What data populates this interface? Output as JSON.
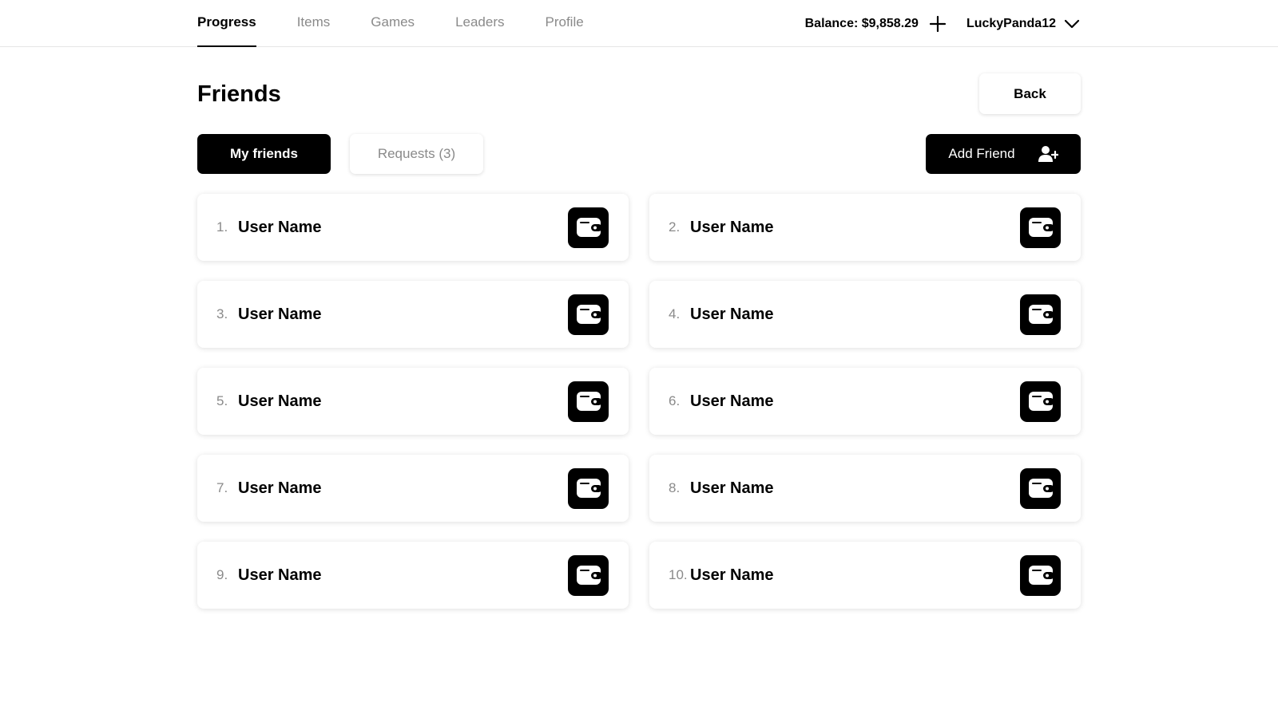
{
  "nav": {
    "items": [
      {
        "label": "Progress",
        "active": true
      },
      {
        "label": "Items",
        "active": false
      },
      {
        "label": "Games",
        "active": false
      },
      {
        "label": "Leaders",
        "active": false
      },
      {
        "label": "Profile",
        "active": false
      }
    ]
  },
  "header": {
    "balance_label": "Balance: $9,858.29",
    "add_funds_icon": "plus-icon",
    "username": "LuckyPanda12",
    "menu_icon": "chevron-down-icon"
  },
  "page": {
    "title": "Friends",
    "back_label": "Back"
  },
  "tabs": {
    "my_friends_label": "My friends",
    "requests_label": "Requests (3)",
    "active": "My friends"
  },
  "add_friend": {
    "label": "Add Friend",
    "icon": "add-person-icon"
  },
  "friends": [
    {
      "rank": "1.",
      "name": "User Name",
      "icon": "wallet-icon"
    },
    {
      "rank": "2.",
      "name": "User Name",
      "icon": "wallet-icon"
    },
    {
      "rank": "3.",
      "name": "User Name",
      "icon": "wallet-icon"
    },
    {
      "rank": "4.",
      "name": "User Name",
      "icon": "wallet-icon"
    },
    {
      "rank": "5.",
      "name": "User Name",
      "icon": "wallet-icon"
    },
    {
      "rank": "6.",
      "name": "User Name",
      "icon": "wallet-icon"
    },
    {
      "rank": "7.",
      "name": "User Name",
      "icon": "wallet-icon"
    },
    {
      "rank": "8.",
      "name": "User Name",
      "icon": "wallet-icon"
    },
    {
      "rank": "9.",
      "name": "User Name",
      "icon": "wallet-icon"
    },
    {
      "rank": "10.",
      "name": "User Name",
      "icon": "wallet-icon"
    }
  ],
  "colors": {
    "primary": "#000000",
    "background": "#ffffff",
    "muted_text": "#8a8a8a",
    "divider": "#e6e6e6"
  }
}
